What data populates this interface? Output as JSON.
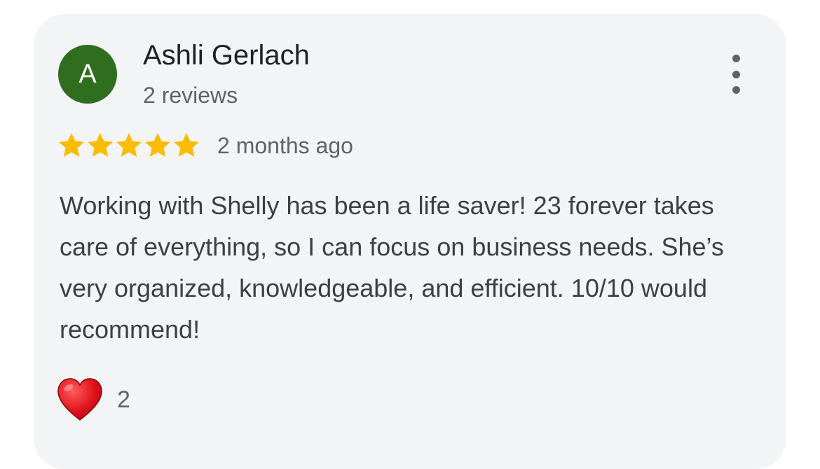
{
  "review": {
    "avatar_letter": "A",
    "avatar_color": "#2f6e1e",
    "reviewer_name": "Ashli Gerlach",
    "review_count": "2 reviews",
    "rating": 5,
    "rating_max": 5,
    "star_color": "#fbbc04",
    "timestamp": "2 months ago",
    "body": "Working with Shelly has been a life saver! 23 forever takes care of everything, so I can focus on business needs. She’s very organized, knowledgeable, and efficient. 10/10 would recommend!",
    "more_icon": "more-vert-icon",
    "reaction_icon": "heart-icon",
    "reaction_count": "2"
  }
}
